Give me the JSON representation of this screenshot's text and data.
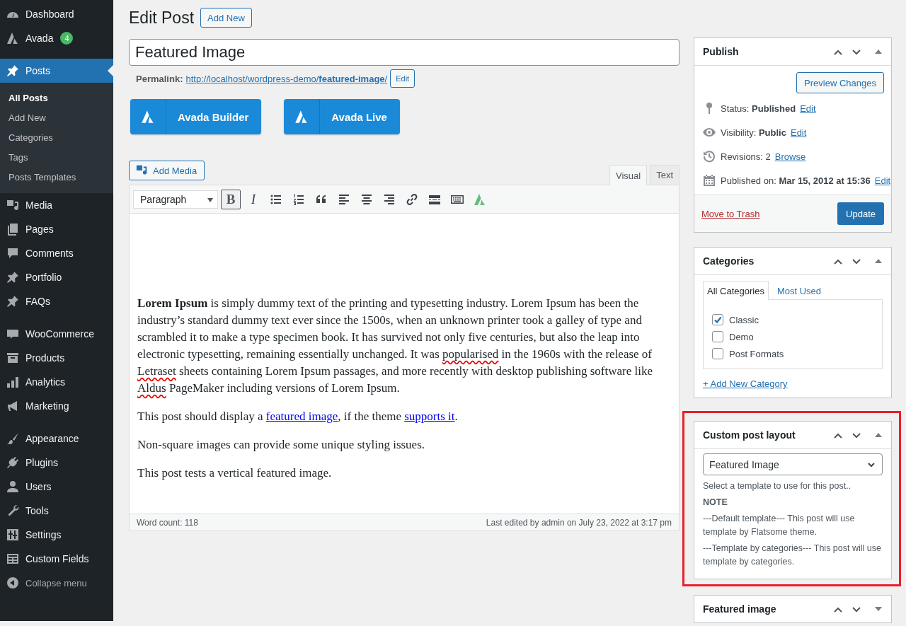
{
  "sidebar": {
    "groups": [
      [
        {
          "label": "Dashboard",
          "selected": false
        },
        {
          "label": "Avada",
          "badge": "4",
          "selected": false
        }
      ],
      [
        {
          "label": "Posts",
          "selected": true,
          "children": [
            {
              "label": "All Posts",
              "selected": true
            },
            {
              "label": "Add New",
              "selected": false
            },
            {
              "label": "Categories",
              "selected": false
            },
            {
              "label": "Tags",
              "selected": false
            },
            {
              "label": "Posts Templates",
              "selected": false
            }
          ]
        },
        {
          "label": "Media",
          "selected": false
        },
        {
          "label": "Pages",
          "selected": false
        },
        {
          "label": "Comments",
          "selected": false
        },
        {
          "label": "Portfolio",
          "selected": false
        },
        {
          "label": "FAQs",
          "selected": false
        }
      ],
      [
        {
          "label": "WooCommerce",
          "selected": false
        },
        {
          "label": "Products",
          "selected": false
        },
        {
          "label": "Analytics",
          "selected": false
        },
        {
          "label": "Marketing",
          "selected": false
        }
      ],
      [
        {
          "label": "Appearance",
          "selected": false
        },
        {
          "label": "Plugins",
          "selected": false
        },
        {
          "label": "Users",
          "selected": false
        },
        {
          "label": "Tools",
          "selected": false
        },
        {
          "label": "Settings",
          "selected": false
        },
        {
          "label": "Custom Fields",
          "selected": false
        }
      ]
    ],
    "collapse_label": "Collapse menu"
  },
  "page_title": "Edit Post",
  "add_new_button": "Add New",
  "title_field": {
    "value": "Featured Image"
  },
  "permalink": {
    "label": "Permalink:",
    "url": "http://localhost/wordpress-demo/**featured-image**/",
    "edit_button": "Edit"
  },
  "builder_buttons": [
    "Avada Builder",
    "Avada Live"
  ],
  "add_media_button": "Add Media",
  "editor": {
    "tabs": [
      {
        "label": "Visual",
        "selected": true
      },
      {
        "label": "Text",
        "selected": false
      }
    ],
    "format": "Paragraph",
    "toolbar": [
      {
        "label": "B",
        "active": true
      },
      {
        "label": "I",
        "active": false
      },
      {
        "active": false
      },
      {
        "active": false
      },
      {
        "active": false
      },
      {
        "active": false
      },
      {
        "active": false
      },
      {
        "active": false
      },
      {
        "active": false
      },
      {
        "active": false
      },
      {
        "active": false
      },
      {
        "active": false
      }
    ],
    "content": [
      {
        "segments": [
          {
            "kind": "text",
            "text": "**Lorem Ipsum** is simply dummy text of the printing and typesetting industry. Lorem Ipsum has been the industry’s standard dummy text ever since the 1500s, when an unknown printer took a galley of type and scrambled it to make a type specimen book. It has survived not only five centuries, but also the leap into electronic typesetting, remaining essentially unchanged. It was "
          },
          {
            "kind": "misspelled",
            "text": "popularised"
          },
          {
            "kind": "text",
            "text": " in the 1960s with the release of "
          },
          {
            "kind": "misspelled",
            "text": "Letraset"
          },
          {
            "kind": "text",
            "text": " sheets containing Lorem Ipsum passages, and more recently with desktop publishing software like "
          },
          {
            "kind": "misspelled",
            "text": "Aldus"
          },
          {
            "kind": "text",
            "text": " PageMaker including versions of Lorem Ipsum."
          }
        ]
      },
      {
        "segments": [
          {
            "kind": "text",
            "text": "This post should display a "
          },
          {
            "kind": "link",
            "text": "featured image"
          },
          {
            "kind": "text",
            "text": ", if the theme "
          },
          {
            "kind": "link",
            "text": "supports it"
          },
          {
            "kind": "text",
            "text": "."
          }
        ]
      },
      {
        "segments": [
          {
            "kind": "text",
            "text": "Non-square images can provide some unique styling issues."
          }
        ]
      },
      {
        "segments": [
          {
            "kind": "text",
            "text": "This post tests a vertical featured image."
          }
        ]
      }
    ],
    "word_count": "Word count: 118",
    "last_edited": "Last edited by admin on July 23, 2022 at 3:17 pm"
  },
  "boxes": [
    {
      "kind": "publish",
      "title": "Publish",
      "collapsed": false,
      "highlighted": false,
      "preview_button": "Preview Changes",
      "rows": [
        {
          "text": "Status: **Published**",
          "link": "Edit"
        },
        {
          "text": "Visibility: **Public**",
          "link": "Edit"
        },
        {
          "text": "Revisions: 2",
          "link": "Browse"
        },
        {
          "text": "Published on: **Mar 15, 2012 at 15:36**",
          "link": "Edit"
        }
      ],
      "trash_link": "Move to Trash",
      "update_button": "Update"
    },
    {
      "kind": "categories",
      "title": "Categories",
      "collapsed": false,
      "highlighted": false,
      "tabs": [
        {
          "label": "All Categories",
          "selected": true
        },
        {
          "label": "Most Used",
          "selected": false
        }
      ],
      "items": [
        {
          "label": "Classic",
          "checked": true
        },
        {
          "label": "Demo",
          "checked": false
        },
        {
          "label": "Post Formats",
          "checked": false
        }
      ],
      "add_link": "+ Add New Category"
    },
    {
      "kind": "layout",
      "title": "Custom post layout",
      "collapsed": false,
      "highlighted": true,
      "select": "Featured Image",
      "help": "Select a template to use for this post..",
      "note_heading": "NOTE",
      "notes": [
        "---Default template--- This post will use template by Flatsome theme.",
        "---Template by categories--- This post will use template by categories."
      ]
    },
    {
      "kind": "featured",
      "title": "Featured image",
      "collapsed": true,
      "highlighted": false
    }
  ]
}
